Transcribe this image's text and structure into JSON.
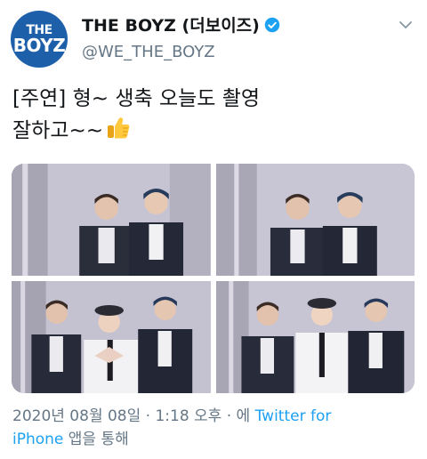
{
  "account": {
    "avatar_text_top": "THE",
    "avatar_text_bottom": "BOYZ",
    "display_name": "THE BOYZ (더보이즈)",
    "handle": "@WE_THE_BOYZ",
    "avatar_icon": "avatar-logo",
    "verified_icon": "verified-badge-icon"
  },
  "tweet": {
    "line1": "[주연] 형~ 생축 오늘도 촬영",
    "line2": "잘하고~~",
    "emoji": "thumbs-up-emoji"
  },
  "media": {
    "photos": [
      {
        "id": "photo-1"
      },
      {
        "id": "photo-2"
      },
      {
        "id": "photo-3"
      },
      {
        "id": "photo-4"
      }
    ]
  },
  "meta": {
    "timestamp": "2020년 08월 08일 · 1:18 오후 · 에",
    "source_link_a": "Twitter for",
    "source_link_b": "iPhone",
    "source_suffix": "앱을 통해"
  },
  "colors": {
    "text": "#14171a",
    "secondary": "#657786",
    "link": "#1da1f2",
    "avatar_bg": "#1d5fa8"
  }
}
